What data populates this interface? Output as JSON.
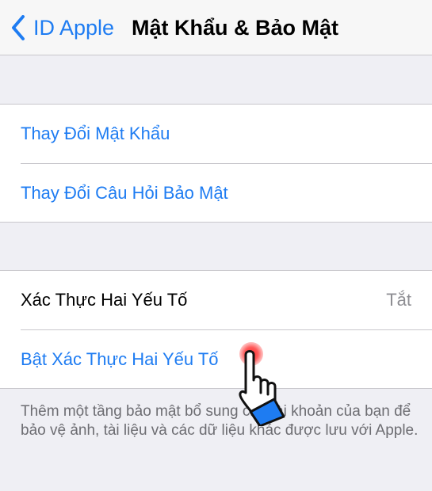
{
  "navbar": {
    "back_label": "ID Apple",
    "title": "Mật Khẩu & Bảo Mật",
    "back_icon": "chevron-left-icon"
  },
  "password_group": {
    "items": [
      {
        "label": "Thay Đổi Mật Khẩu"
      },
      {
        "label": "Thay Đổi Câu Hỏi Bảo Mật"
      }
    ]
  },
  "two_factor_group": {
    "status_label": "Xác Thực Hai Yếu Tố",
    "status_value": "Tắt",
    "enable_label": "Bật Xác Thực Hai Yếu Tố"
  },
  "footer_text": "Thêm một tầng bảo mật bổ sung cho tài khoản của bạn để bảo vệ ảnh, tài liệu và các dữ liệu khác được lưu với Apple.",
  "colors": {
    "accent": "#1e7cf2",
    "background": "#efeff4",
    "separator": "#c8c7cc",
    "tap_indicator": "#ff2a2a"
  },
  "overlay": {
    "pointer_icon": "hand-pointer-icon"
  }
}
